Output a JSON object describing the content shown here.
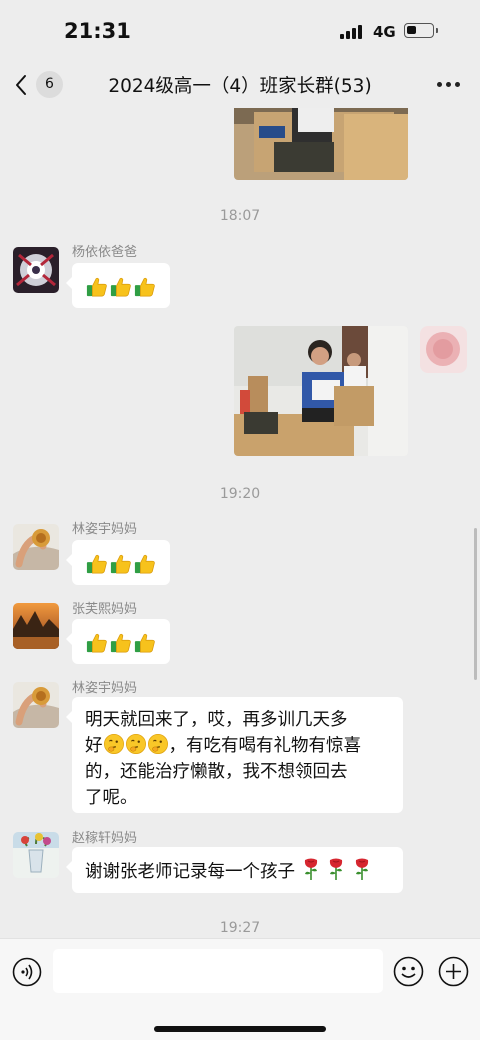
{
  "status_bar": {
    "time": "21:31",
    "network": "4G"
  },
  "header": {
    "unread_count": "6",
    "title": "2024级高一（4）班家长群(53)"
  },
  "messages": {
    "time1": "18:07",
    "msg1": {
      "sender": "杨依依爸爸",
      "content": "thumbs-up ×3"
    },
    "msg2": {
      "sender": "self",
      "content": "photo"
    },
    "time2": "19:20",
    "msg3": {
      "sender": "林姿宇妈妈",
      "content": "thumbs-up ×3"
    },
    "msg4": {
      "sender": "张芙熙妈妈",
      "content": "thumbs-up ×3"
    },
    "msg5": {
      "sender": "林姿宇妈妈",
      "line1": "明天就回来了，哎，再多训几天多",
      "line2_start": "好",
      "line2_end": "，有吃有喝有礼物有惊喜",
      "line3": "的，还能治疗懒散，我不想领回去",
      "line4": "了呢。"
    },
    "msg6": {
      "sender": "赵稼轩妈妈",
      "text": "谢谢张老师记录每一个孩子"
    },
    "time3": "19:27"
  },
  "input": {
    "placeholder": ""
  },
  "icons": {
    "back": "chevron-left-icon",
    "more": "more-dots-icon",
    "thumbs": "thumbs-up-icon",
    "voice": "voice-icon",
    "emoji": "emoji-icon",
    "plus": "plus-icon",
    "rose": "rose-icon"
  }
}
